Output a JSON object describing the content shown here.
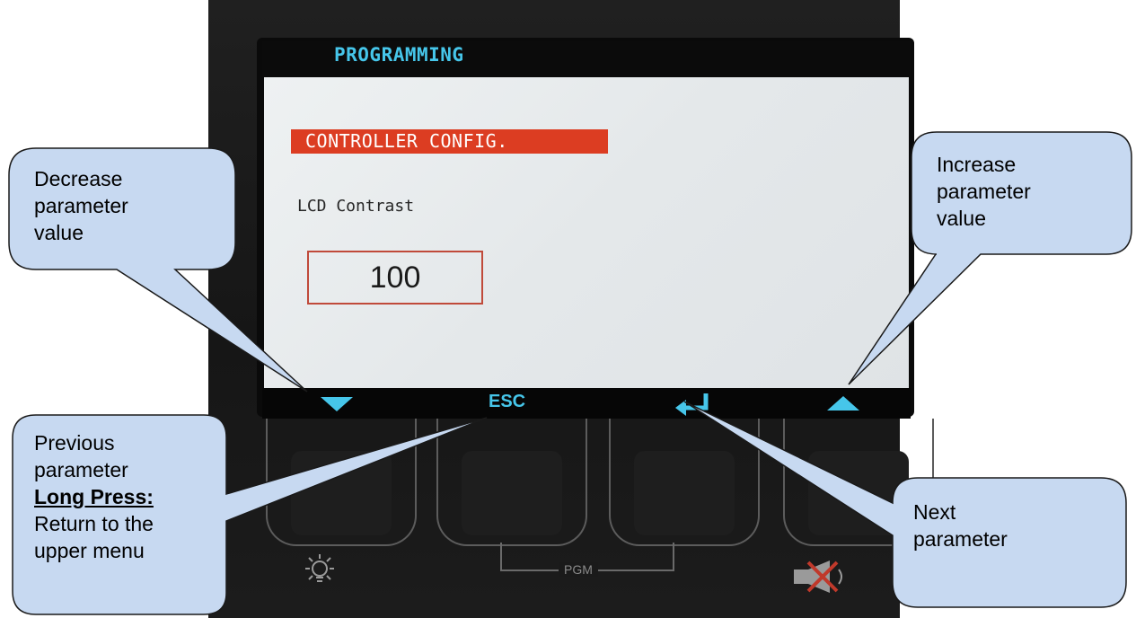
{
  "screen": {
    "header_title": "PROGRAMMING",
    "section_title": "CONTROLLER CONFIG.",
    "parameter_name": "LCD Contrast",
    "parameter_value": "100"
  },
  "softkeys": {
    "down_icon": "triangle-down-icon",
    "esc_label": "ESC",
    "enter_icon": "enter-return-icon",
    "up_icon": "triangle-up-icon"
  },
  "panel": {
    "pgm_label": "PGM",
    "left_icon": "light-bulb-icon",
    "right_icon": "mute-horn-icon"
  },
  "callouts": {
    "decrease": {
      "lines": [
        "Decrease",
        "parameter",
        "value"
      ]
    },
    "increase": {
      "lines": [
        "Increase",
        "parameter",
        "value"
      ]
    },
    "previous": {
      "lines": [
        "Previous",
        "parameter"
      ],
      "long_press_label": "Long Press:",
      "long_press_lines": [
        "Return to the",
        "upper menu"
      ]
    },
    "next": {
      "lines": [
        "Next",
        "parameter"
      ]
    }
  },
  "colors": {
    "accent_cyan": "#46c6ea",
    "section_red": "#dc3d22",
    "callout_fill": "#c7d9f1",
    "callout_stroke": "#1a1a1a"
  }
}
